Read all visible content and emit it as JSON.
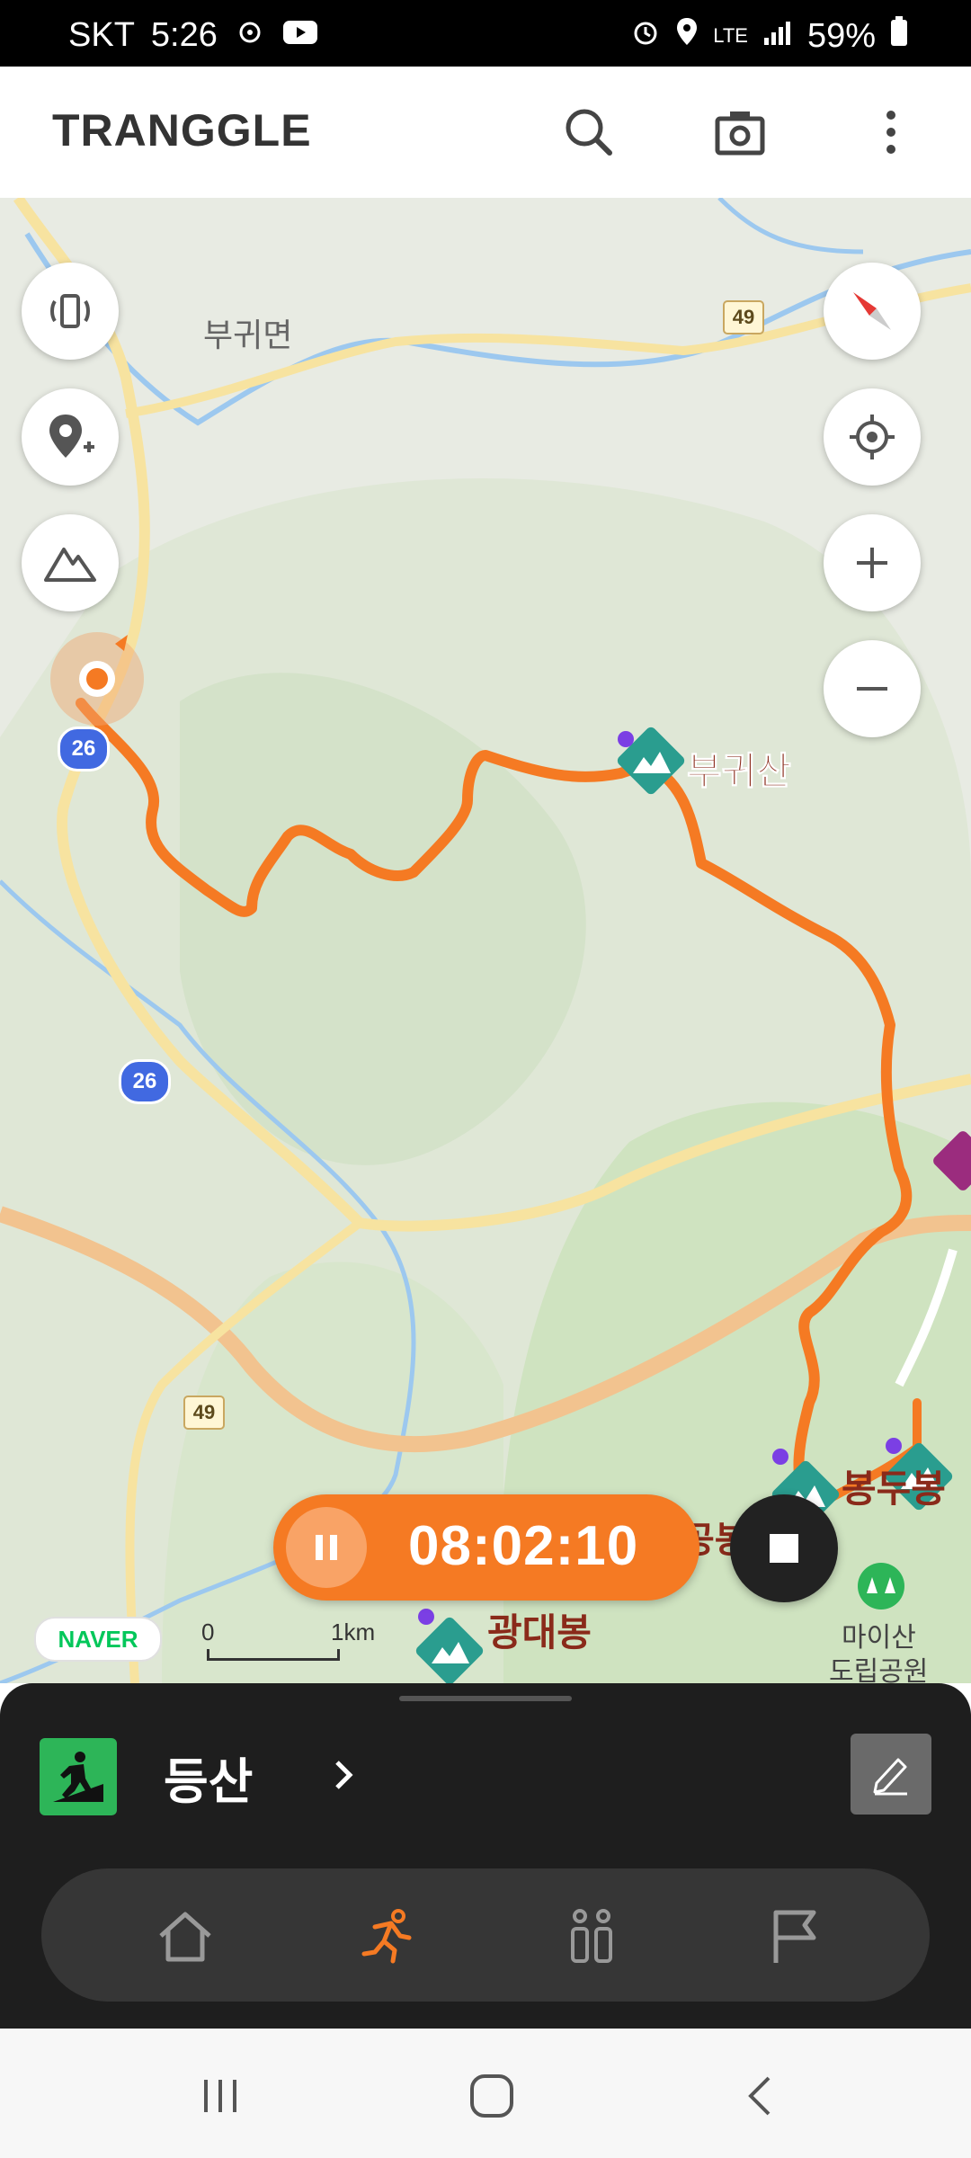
{
  "status_bar": {
    "carrier": "SKT",
    "time": "5:26",
    "network": "LTE",
    "battery": "59%"
  },
  "app_bar": {
    "logo": "TRANGGLE"
  },
  "map": {
    "place_labels": {
      "buguimyeon": "부귀면",
      "bugwisan": "부귀산",
      "bongdubong": "봉두봉",
      "gwangdaebong": "광대봉",
      "partial_peak": "공봉",
      "maisan": "마이산",
      "park": "도립공원"
    },
    "route_shields": {
      "r49_top": "49",
      "r26_a": "26",
      "r26_b": "26",
      "r49_bottom": "49"
    },
    "attribution": "NAVER",
    "scale": {
      "zero": "0",
      "one": "1km"
    },
    "colors": {
      "route": "#f57a23",
      "mountain": "#2a9d8f"
    }
  },
  "tracking": {
    "elapsed": "08:02:10"
  },
  "bottom_sheet": {
    "activity_label": "등산",
    "activity_color": "#2db558"
  },
  "tabs": [
    {
      "name": "home",
      "icon": "home-icon",
      "active": false
    },
    {
      "name": "activity",
      "icon": "running-icon",
      "active": true
    },
    {
      "name": "community",
      "icon": "people-icon",
      "active": false
    },
    {
      "name": "challenge",
      "icon": "flag-icon",
      "active": false
    }
  ]
}
